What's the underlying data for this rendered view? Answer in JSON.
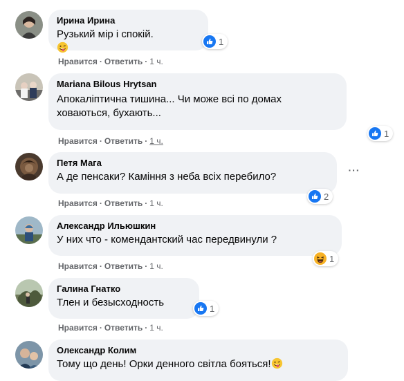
{
  "comments": [
    {
      "author": "Ирина Ирина",
      "text": "Рузький мір і спокій.",
      "like_label": "Нравится",
      "reply_label": "Ответить",
      "time": "1 ч.",
      "reaction_count": "1",
      "reaction_type": "like-icon",
      "trailing_emoji": "winking-tongue-emoji"
    },
    {
      "author": "Mariana Bilous Hrytsan",
      "text": "Апокаліптична тишина... Чи може всі по домах\nховаються, бухають...",
      "like_label": "Нравится",
      "reply_label": "Ответить",
      "time": "1 ч.",
      "reaction_count": "1",
      "reaction_type": "like-icon"
    },
    {
      "author": "Петя Мага",
      "text": "А де пенсаки? Каміння з неба всіх перебило?",
      "like_label": "Нравится",
      "reply_label": "Ответить",
      "time": "1 ч.",
      "reaction_count": "2",
      "reaction_type": "like-icon",
      "more_icon": "more-options-icon"
    },
    {
      "author": "Александр Ильюшкин",
      "text": "У них что - комендантский час передвинули ?",
      "like_label": "Нравится",
      "reply_label": "Ответить",
      "time": "1 ч.",
      "reaction_count": "1",
      "reaction_type": "haha-icon"
    },
    {
      "author": "Галина Гнатко",
      "text": "Тлен и безысходность",
      "like_label": "Нравится",
      "reply_label": "Ответить",
      "time": "1 ч.",
      "reaction_count": "1",
      "reaction_type": "like-icon"
    },
    {
      "author": "Олександр Колим",
      "text": "Тому що день! Орки денного світла бояться!",
      "trailing_emoji": "winking-tongue-emoji"
    }
  ],
  "colors": {
    "bubble_bg": "#f0f2f5",
    "secondary_text": "#65676b",
    "like_blue": "#1877f2",
    "haha_yellow": "#f7b125"
  }
}
